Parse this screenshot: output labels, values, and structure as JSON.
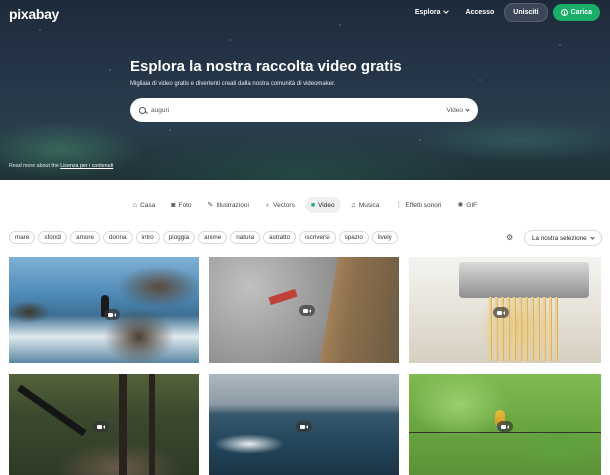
{
  "header": {
    "logo": "pixabay",
    "nav": {
      "explore": "Esplora",
      "login": "Accesso",
      "join": "Unisciti",
      "upload": "Carica"
    }
  },
  "hero": {
    "title": "Esplora la nostra raccolta video gratis",
    "subtitle": "Migliaia di video gratis e divertenti creati dalla nostra comunità di videomaker.",
    "search": {
      "value": "auguri",
      "type": "Video"
    },
    "license_prefix": "Read more about the",
    "license_link": "Licenza per i contenuti"
  },
  "tabs": [
    {
      "label": "Casa",
      "icon": "home-icon"
    },
    {
      "label": "Foto",
      "icon": "camera-icon"
    },
    {
      "label": "Illustrazioni",
      "icon": "brush-icon"
    },
    {
      "label": "Vectors",
      "icon": "pen-icon"
    },
    {
      "label": "Video",
      "icon": "video-icon",
      "active": true
    },
    {
      "label": "Musica",
      "icon": "music-icon"
    },
    {
      "label": "Effetti sonori",
      "icon": "sound-icon"
    },
    {
      "label": "GIF",
      "icon": "gif-icon"
    }
  ],
  "tags": [
    "mare",
    "sfondi",
    "amore",
    "donna",
    "intro",
    "pioggia",
    "anime",
    "natura",
    "astratto",
    "iscriversi",
    "spazio",
    "lively"
  ],
  "sort": {
    "label": "La nostra selezione"
  },
  "colors": {
    "brand_green": "#1aaf68",
    "join_bg": "#3b4656"
  }
}
